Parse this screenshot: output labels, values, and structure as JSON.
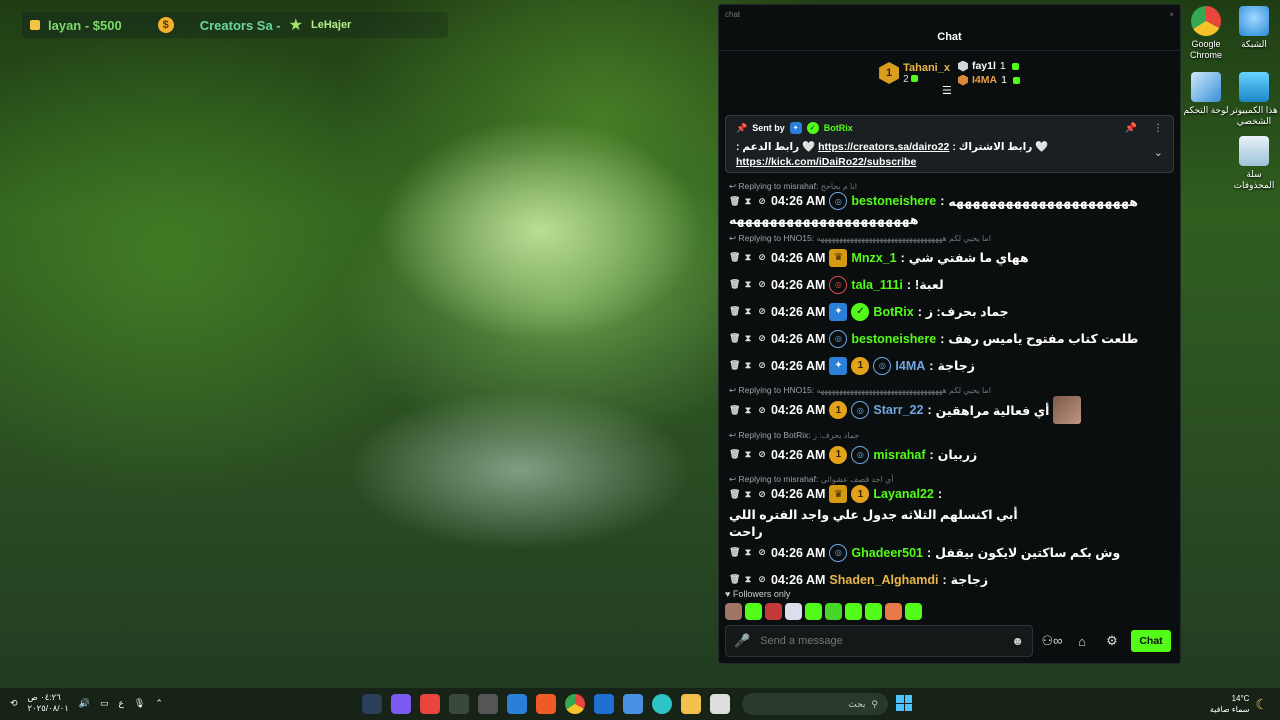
{
  "overlay": {
    "left_text": "layan - $500",
    "creators_text": "Creators Sa -",
    "lehajer_text": "LeHajer"
  },
  "desktop_icons": [
    {
      "label": "Google Chrome",
      "icon": "chrome-icon",
      "color": "#e8453c"
    },
    {
      "label": "الشبكة",
      "icon": "network-icon",
      "color": "#4aa8e8"
    },
    {
      "label": "لوحة التحكم",
      "icon": "control-panel-icon",
      "color": "#5aa0d8"
    },
    {
      "label": "هذا الكمبيوتر الشخصي",
      "icon": "this-pc-icon",
      "color": "#3fb5e5"
    },
    {
      "label": "سلة المحذوفات",
      "icon": "recycle-bin-icon",
      "color": "#cfe4f0"
    }
  ],
  "window": {
    "title": "chat",
    "close_label": "×"
  },
  "chat": {
    "header": "Chat",
    "leaderboard": {
      "first": {
        "rank": "1",
        "name": "Tahani_x",
        "count": "2"
      },
      "second": {
        "name": "fay1l",
        "count": "1"
      },
      "third": {
        "name": "I4MA",
        "count": "1"
      }
    },
    "pinned": {
      "sent_by_label": "Sent by",
      "sender": "BotRix",
      "message_prefix": "🤍 رابط الاشتراك :",
      "link1": "https://creators.sa/dairo22",
      "message_mid": "🤍 رابط الدعم :",
      "link2": "https://kick.com/iDaiRo22/subscribe"
    },
    "messages": [
      {
        "reply": "Replying to misrahaf:",
        "reply_text": "انا م بحاحح",
        "time": "04:26 AM",
        "badges": [
          "tier"
        ],
        "user": "bestoneishere",
        "color": "#53fc18",
        "text": "ههههههههههههههههههههههه",
        "cont": "ههههههههههههههههههههههه"
      },
      {
        "reply": "Replying to HNO15:",
        "reply_text": "اما يحبي لكم ههههههههههههههههههههههههههههههههههه",
        "time": "04:26 AM",
        "badges": [
          "crown"
        ],
        "user": "Mnzx_1",
        "color": "#53fc18",
        "text": "ههاي ما شفتي شي"
      },
      {
        "time": "04:26 AM",
        "badges": [
          "red"
        ],
        "user": "tala_111i",
        "color": "#53fc18",
        "text": "لعبة!"
      },
      {
        "time": "04:26 AM",
        "badges": [
          "bot",
          "verified"
        ],
        "user": "BotRix",
        "color": "#53fc18",
        "text": "جماد بحرف: ز"
      },
      {
        "time": "04:26 AM",
        "badges": [
          "tier"
        ],
        "user": "bestoneishere",
        "color": "#53fc18",
        "text": "طلعت كتاب مفتوح ياميس رهف"
      },
      {
        "time": "04:26 AM",
        "badges": [
          "bot",
          "sub",
          "tier"
        ],
        "user": "I4MA",
        "color": "#6fa7e0",
        "text": "زجاجة"
      },
      {
        "reply": "Replying to HNO15:",
        "reply_text": "اما يحبي لكم ههههههههههههههههههههههههههههههههههه",
        "time": "04:26 AM",
        "badges": [
          "sub",
          "tier"
        ],
        "user": "Starr_22",
        "color": "#6fa7e0",
        "text": "أي فعالية مراهقين",
        "emote": true
      },
      {
        "reply": "Replying to BotRix:",
        "reply_text": "جماد بحرف: ز",
        "time": "04:26 AM",
        "badges": [
          "sub",
          "tier"
        ],
        "user": "misrahaf",
        "color": "#53fc18",
        "text": "زربيان"
      },
      {
        "reply": "Replying to misrahaf:",
        "reply_text": "أي احد قصف عشوائي",
        "time": "04:26 AM",
        "badges": [
          "crown",
          "sub"
        ],
        "user": "Layanal22",
        "color": "#53fc18",
        "text": "أبي اكنسلهم الثلاثه جدول علي واجد الفتره اللي",
        "cont": "راحت"
      },
      {
        "time": "04:26 AM",
        "badges": [
          "tier"
        ],
        "user": "Ghadeer501",
        "color": "#53fc18",
        "text": "وش بكم ساكتين لايكون بيقفل"
      },
      {
        "time": "04:26 AM",
        "badges": [],
        "user": "Shaden_Alghamdi",
        "color": "#e8b64a",
        "text": "زجاجة"
      }
    ],
    "followers_only": "Followers only",
    "input_placeholder": "Send a message",
    "send_label": "Chat"
  },
  "taskbar": {
    "time": "٠٤:٢٦ ص",
    "date": "٢٠٢٥/٠٨/٠١",
    "lang": "ع",
    "search_placeholder": "بحث",
    "weather_temp": "14°C",
    "weather_desc": "سماء صافية"
  }
}
